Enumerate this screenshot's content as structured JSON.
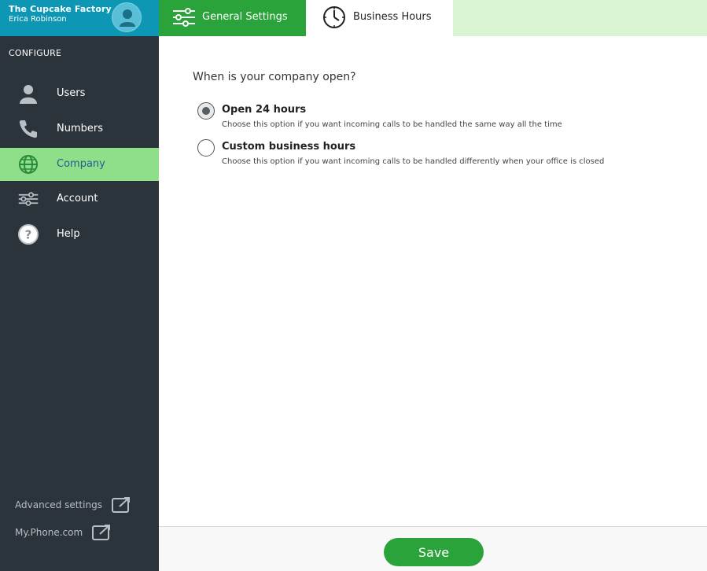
{
  "brand": {
    "company": "The Cupcake Factory",
    "user": "Erica Robinson"
  },
  "sidebar": {
    "section_label": "CONFIGURE",
    "items": [
      {
        "label": "Users",
        "icon": "user-icon",
        "active": false
      },
      {
        "label": "Numbers",
        "icon": "phone-icon",
        "active": false
      },
      {
        "label": "Company",
        "icon": "globe-icon",
        "active": true
      },
      {
        "label": "Account",
        "icon": "sliders-icon",
        "active": false
      },
      {
        "label": "Help",
        "icon": "help-icon",
        "active": false
      }
    ],
    "footer_links": [
      {
        "label": "Advanced settings",
        "icon": "external-link-icon"
      },
      {
        "label": "My.Phone.com",
        "icon": "external-link-icon"
      }
    ]
  },
  "tabs": [
    {
      "label": "General Settings",
      "icon": "sliders-icon",
      "selected": false
    },
    {
      "label": "Business Hours",
      "icon": "clock-icon",
      "selected": true
    }
  ],
  "main": {
    "question": "When is your company open?",
    "options": [
      {
        "title": "Open 24 hours",
        "description": "Choose this option if you want incoming calls to be handled the same way all the time",
        "checked": true
      },
      {
        "title": "Custom business hours",
        "description": "Choose this option if you want incoming calls to be handled differently when your office is closed",
        "checked": false
      }
    ]
  },
  "actions": {
    "save_label": "Save"
  },
  "colors": {
    "sidebar_bg": "#2c343b",
    "brand_bg": "#0e96b5",
    "accent_green": "#2aa33a",
    "active_nav_bg": "#8fdf8a",
    "active_nav_text": "#1c5f93",
    "tab_strip_bg": "#d9f5d4"
  }
}
